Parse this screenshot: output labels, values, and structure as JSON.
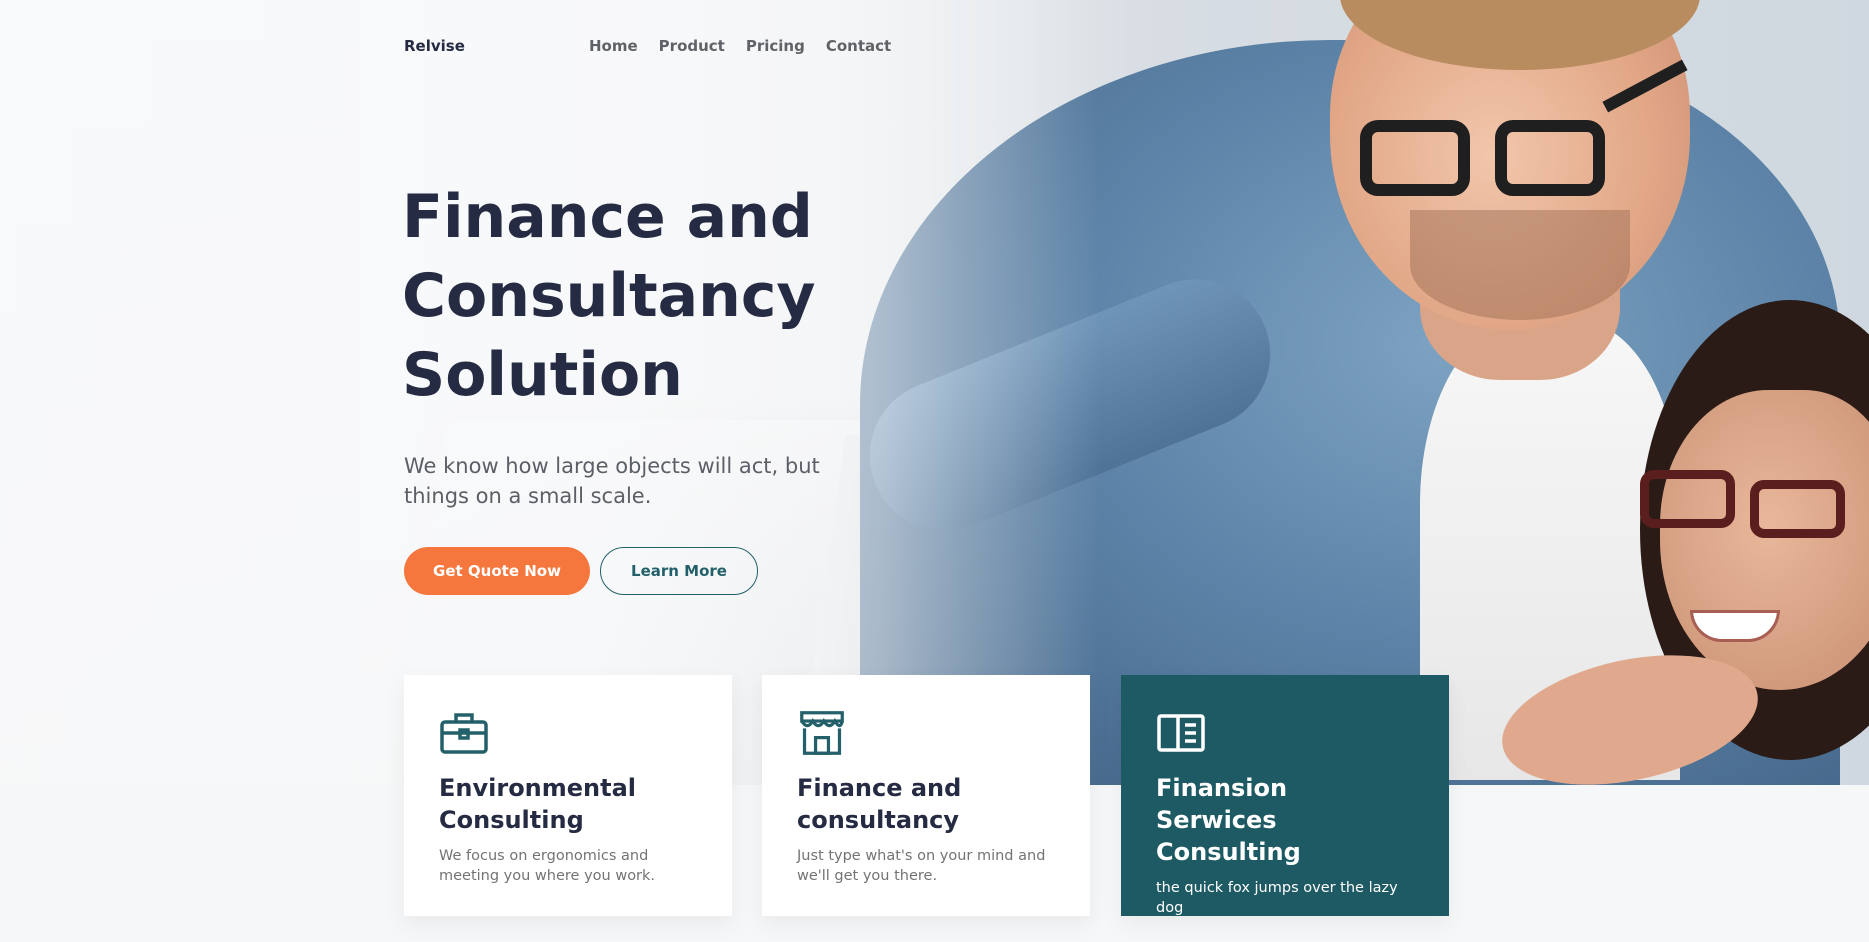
{
  "brand": {
    "name": "Relvise"
  },
  "nav": {
    "items": [
      {
        "label": "Home"
      },
      {
        "label": "Product"
      },
      {
        "label": "Pricing"
      },
      {
        "label": "Contact"
      }
    ]
  },
  "hero": {
    "title": "Finance and Consultancy Solution",
    "subtitle": "We know how large objects will act, but things on a small scale.",
    "primary_button": "Get Quote Now",
    "secondary_button": "Learn More"
  },
  "cards": [
    {
      "icon": "briefcase-icon",
      "title": "Environmental Consulting",
      "text": "We focus on ergonomics and meeting you where you work."
    },
    {
      "icon": "storefront-icon",
      "title": "Finance and consultancy",
      "text": "Just type what's on your mind and we'll get you there."
    },
    {
      "icon": "book-open-icon",
      "title": "Finansion Serwices Consulting",
      "text": "the quick fox jumps over the lazy dog"
    }
  ],
  "colors": {
    "primary_text": "#252b42",
    "accent_orange": "#f5773d",
    "accent_teal": "#1e5a63",
    "muted_text": "#737373"
  }
}
